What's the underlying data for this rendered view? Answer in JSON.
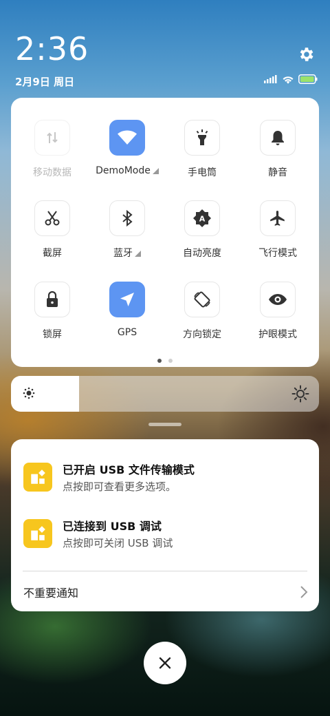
{
  "status": {
    "time": "2:36",
    "date": "2月9日 周日"
  },
  "tiles": [
    {
      "label": "移动数据",
      "icon": "mobile-data-icon",
      "state": "disabled"
    },
    {
      "label": "DemoMode",
      "icon": "wifi-icon",
      "state": "active",
      "has_caret": true
    },
    {
      "label": "手电筒",
      "icon": "flashlight-icon",
      "state": "off"
    },
    {
      "label": "静音",
      "icon": "bell-icon",
      "state": "off"
    },
    {
      "label": "截屏",
      "icon": "scissors-icon",
      "state": "off"
    },
    {
      "label": "蓝牙",
      "icon": "bluetooth-icon",
      "state": "off",
      "has_caret": true
    },
    {
      "label": "自动亮度",
      "icon": "auto-brightness-icon",
      "state": "off"
    },
    {
      "label": "飞行模式",
      "icon": "airplane-icon",
      "state": "off"
    },
    {
      "label": "锁屏",
      "icon": "lock-icon",
      "state": "off"
    },
    {
      "label": "GPS",
      "icon": "location-arrow-icon",
      "state": "active"
    },
    {
      "label": "方向锁定",
      "icon": "rotation-lock-icon",
      "state": "off"
    },
    {
      "label": "护眼模式",
      "icon": "eye-icon",
      "state": "off"
    }
  ],
  "pages": {
    "count": 2,
    "current": 1
  },
  "brightness": {
    "level": 0.22
  },
  "notifications": [
    {
      "title": "已开启 USB 文件传输模式",
      "subtitle": "点按即可查看更多选项。",
      "icon": "android-settings-icon"
    },
    {
      "title": "已连接到 USB 调试",
      "subtitle": "点按即可关闭 USB 调试",
      "icon": "android-settings-icon"
    }
  ],
  "unimportant_label": "不重要通知",
  "colors": {
    "accent": "#5d95f2",
    "notif_icon": "#f7c61e"
  }
}
